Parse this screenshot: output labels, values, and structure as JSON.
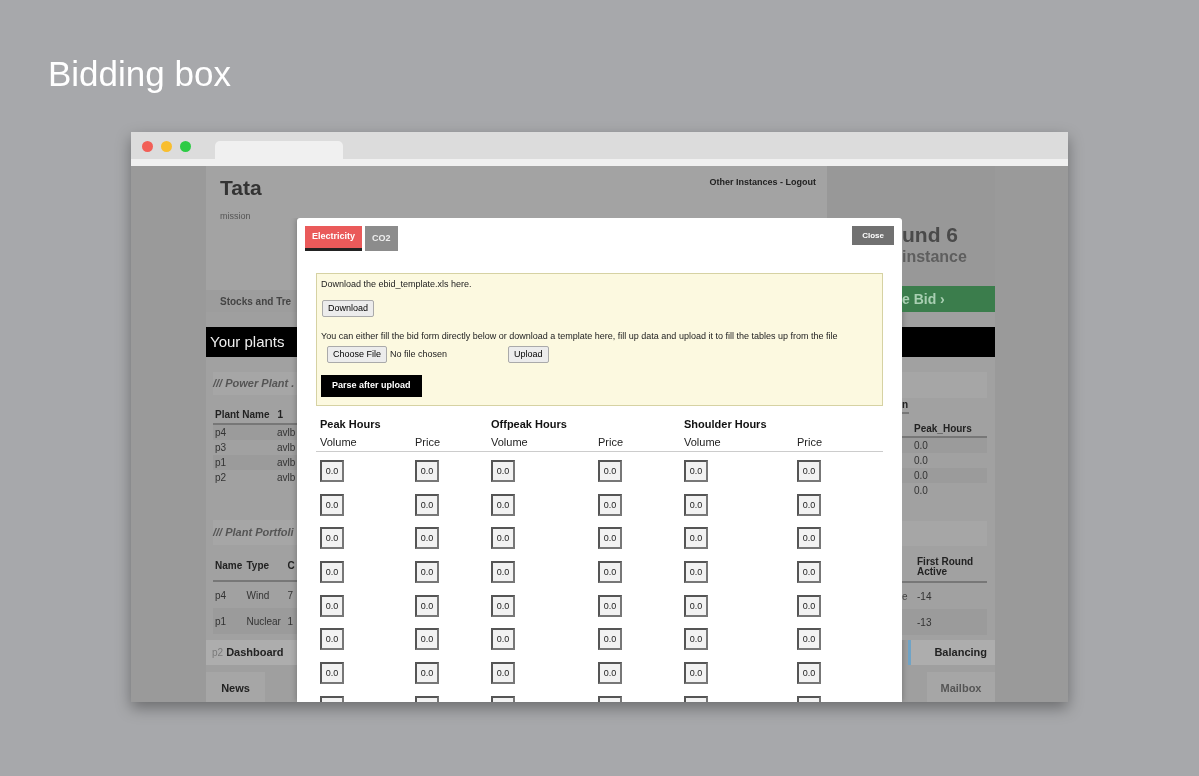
{
  "slide_title": "Bidding box",
  "app": {
    "header": {
      "title": "Tata",
      "subtitle": "mission",
      "links": "Other Instances - Logout"
    },
    "left": {
      "menu_item": "Stocks and Tre",
      "section_bar": "Your plants",
      "plants_heading": "/// Power Plant .",
      "plants_columns": [
        "Plant Name",
        "1"
      ],
      "plants_rows": [
        [
          "p4",
          "avlb"
        ],
        [
          "p3",
          "avlb"
        ],
        [
          "p1",
          "avlb"
        ],
        [
          "p2",
          "avlb"
        ]
      ],
      "portfolio_heading": "/// Plant Portfoli",
      "portfolio_columns": [
        "Name",
        "Type",
        "C"
      ],
      "portfolio_rows": [
        [
          "p4",
          "Wind",
          "7"
        ],
        [
          "p1",
          "Nuclear",
          "1"
        ]
      ],
      "faint_row_start": "p2",
      "nav_item": "Dashboard",
      "tab": "News"
    },
    "right": {
      "round": "und 6",
      "instance": "instance",
      "bid_button": "e Bid ›",
      "table_heading": "n",
      "column": "Peak_Hours",
      "values": [
        "0.0",
        "0.0",
        "0.0",
        "0.0"
      ],
      "portfolio_column": "First Round Active",
      "stray_text": "e",
      "portfolio_cells": [
        "-14",
        "-13"
      ],
      "nav_item": "Balancing",
      "tab": "Mailbox"
    }
  },
  "modal": {
    "tabs": [
      {
        "label": "Electricity",
        "selected": true
      },
      {
        "label": "CO2",
        "selected": false
      }
    ],
    "close_button": "Close",
    "upload_panel": {
      "download_text": "Download the ebid_template.xls here.",
      "download_button": "Download",
      "instructions": "You can either fill the bid form directly below or download a template here, fill up data and upload it to fill the tables up from the file",
      "choose_button": "Choose File",
      "file_status": "No file chosen",
      "upload_button": "Upload",
      "parse_button": "Parse after upload"
    },
    "bid_table": {
      "groups": [
        {
          "title": "Peak Hours",
          "columns": [
            "Volume",
            "Price"
          ]
        },
        {
          "title": "Offpeak Hours",
          "columns": [
            "Volume",
            "Price"
          ]
        },
        {
          "title": "Shoulder Hours",
          "columns": [
            "Volume",
            "Price"
          ]
        }
      ],
      "rows": [
        [
          "0.0",
          "0.0",
          "0.0",
          "0.0",
          "0.0",
          "0.0"
        ],
        [
          "0.0",
          "0.0",
          "0.0",
          "0.0",
          "0.0",
          "0.0"
        ],
        [
          "0.0",
          "0.0",
          "0.0",
          "0.0",
          "0.0",
          "0.0"
        ],
        [
          "0.0",
          "0.0",
          "0.0",
          "0.0",
          "0.0",
          "0.0"
        ],
        [
          "0.0",
          "0.0",
          "0.0",
          "0.0",
          "0.0",
          "0.0"
        ],
        [
          "0.0",
          "0.0",
          "0.0",
          "0.0",
          "0.0",
          "0.0"
        ],
        [
          "0.0",
          "0.0",
          "0.0",
          "0.0",
          "0.0",
          "0.0"
        ]
      ]
    }
  }
}
